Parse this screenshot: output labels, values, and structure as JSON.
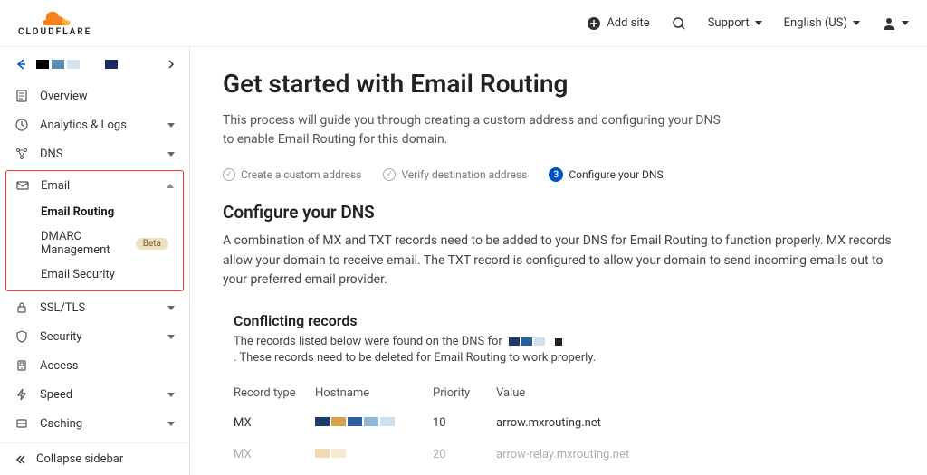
{
  "header": {
    "add_site": "Add site",
    "support": "Support",
    "language": "English (US)"
  },
  "sidebar": {
    "items": [
      {
        "label": "Overview",
        "icon": "document"
      },
      {
        "label": "Analytics & Logs",
        "icon": "clock",
        "caret": true
      },
      {
        "label": "DNS",
        "icon": "dns",
        "caret": true
      }
    ],
    "email_group": {
      "label": "Email",
      "sub": [
        {
          "label": "Email Routing",
          "active": true
        },
        {
          "label": "DMARC Management",
          "beta": "Beta"
        },
        {
          "label": "Email Security"
        }
      ]
    },
    "items2": [
      {
        "label": "SSL/TLS",
        "icon": "lock",
        "caret": true
      },
      {
        "label": "Security",
        "icon": "shield",
        "caret": true
      },
      {
        "label": "Access",
        "icon": "access"
      },
      {
        "label": "Speed",
        "icon": "bolt",
        "caret": true
      },
      {
        "label": "Caching",
        "icon": "drawer",
        "caret": true
      }
    ],
    "collapse": "Collapse sidebar"
  },
  "main": {
    "title": "Get started with Email Routing",
    "subtitle": "This process will guide you through creating a custom address and configuring your DNS to enable Email Routing for this domain.",
    "steps": [
      {
        "label": "Create a custom address",
        "done": true
      },
      {
        "label": "Verify destination address",
        "done": true
      },
      {
        "label": "Configure your DNS",
        "num": "3",
        "active": true
      }
    ],
    "section_title": "Configure your DNS",
    "section_desc": "A combination of MX and TXT records need to be added to your DNS for Email Routing to function properly. MX records allow your domain to receive email. The TXT record is configured to allow your domain to send incoming emails out to your preferred email provider.",
    "conflict_title": "Conflicting records",
    "conflict_desc_a": "The records listed below were found on the DNS for",
    "conflict_desc_b": ". These records need to be deleted for Email Routing to work properly.",
    "table": {
      "headers": [
        "Record type",
        "Hostname",
        "Priority",
        "Value"
      ],
      "rows": [
        {
          "type": "MX",
          "priority": "10",
          "value": "arrow.mxrouting.net"
        },
        {
          "type": "MX",
          "priority": "20",
          "value": "arrow-relay.mxrouting.net"
        }
      ]
    }
  }
}
